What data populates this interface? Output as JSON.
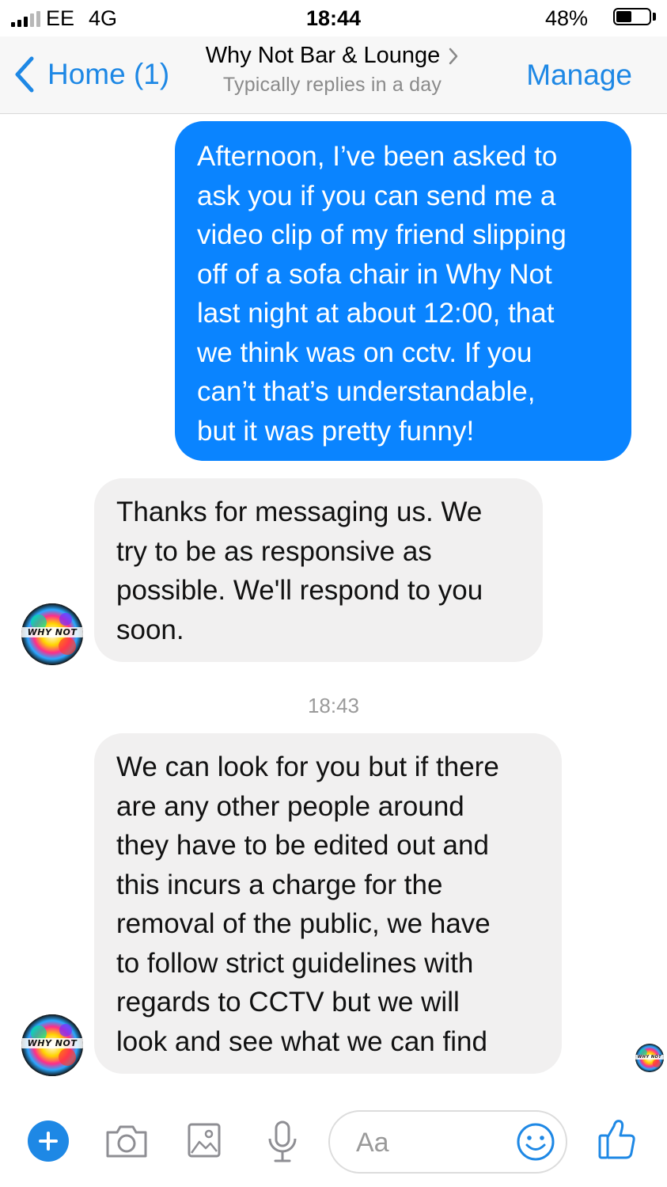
{
  "status_bar": {
    "carrier": "EE",
    "network": "4G",
    "time": "18:44",
    "battery_percent": "48%",
    "battery_level": 0.48
  },
  "nav": {
    "back_label": "Home (1)",
    "title": "Why Not Bar & Lounge",
    "subtitle": "Typically replies in a day",
    "manage_label": "Manage"
  },
  "messages": [
    {
      "direction": "outgoing",
      "lines": [
        "Afternoon, I’ve been asked to",
        "ask you if you can send me a",
        "video clip of my friend slipping",
        "off of a sofa chair in Why Not",
        "last night at about 12:00, that",
        "we think was on cctv. If you",
        "can’t that’s understandable,",
        "but it was pretty funny!"
      ]
    },
    {
      "direction": "incoming",
      "lines": [
        "Thanks for messaging us. We",
        "try to be as responsive as",
        "possible. We'll respond to you",
        "soon."
      ]
    },
    {
      "direction": "incoming",
      "lines": [
        "We can look for you but if there",
        "are any other people around",
        "they have to be edited out and",
        "this incurs a charge for the",
        "removal of the public, we have",
        "to follow strict guidelines with",
        "regards to CCTV but we will",
        "look and see what we can find"
      ]
    }
  ],
  "timestamp": "18:43",
  "avatar_logo_text": "WHY NOT",
  "composer": {
    "placeholder": "Aa"
  },
  "colors": {
    "accent": "#1e88e5",
    "outgoing_bubble": "#0a84ff",
    "incoming_bubble": "#f1f0f0"
  },
  "icons": [
    "signal-icon",
    "battery-icon",
    "back-chevron-icon",
    "chevron-right-icon",
    "plus-icon",
    "camera-icon",
    "photo-icon",
    "microphone-icon",
    "emoji-icon",
    "thumbs-up-icon"
  ]
}
